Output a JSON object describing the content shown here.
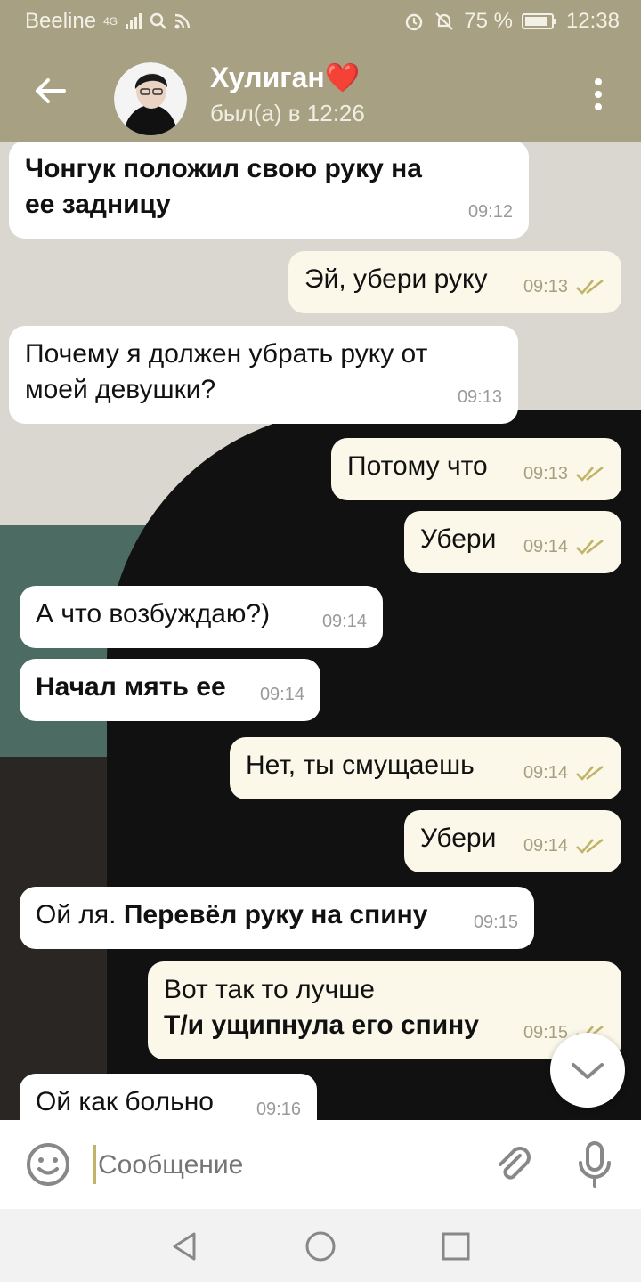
{
  "status_bar": {
    "carrier": "Beeline",
    "network": "4G",
    "battery": "75 %",
    "time": "12:38"
  },
  "header": {
    "title": "Хулиган❤️",
    "subtitle": "был(а) в 12:26"
  },
  "messages": [
    {
      "side": "in",
      "parts": [
        {
          "text": "Чонгук положил свою руку на ее задницу",
          "bold": true
        }
      ],
      "time": "09:12"
    },
    {
      "side": "out",
      "parts": [
        {
          "text": "Эй, убери руку",
          "bold": false
        }
      ],
      "time": "09:13"
    },
    {
      "side": "in",
      "parts": [
        {
          "text": "Почему я должен убрать руку от моей девушки?",
          "bold": false
        }
      ],
      "time": "09:13"
    },
    {
      "side": "out",
      "parts": [
        {
          "text": "Потому что",
          "bold": false
        }
      ],
      "time": "09:13"
    },
    {
      "side": "out",
      "parts": [
        {
          "text": "Убери",
          "bold": false
        }
      ],
      "time": "09:14"
    },
    {
      "side": "in",
      "parts": [
        {
          "text": "А что возбуждаю?)",
          "bold": false
        }
      ],
      "time": "09:14"
    },
    {
      "side": "in",
      "parts": [
        {
          "text": "Начал мять ее",
          "bold": true
        }
      ],
      "time": "09:14"
    },
    {
      "side": "out",
      "parts": [
        {
          "text": "Нет, ты смущаешь",
          "bold": false
        }
      ],
      "time": "09:14"
    },
    {
      "side": "out",
      "parts": [
        {
          "text": "Убери",
          "bold": false
        }
      ],
      "time": "09:14"
    },
    {
      "side": "in",
      "parts": [
        {
          "text": "Ой ля. ",
          "bold": false
        },
        {
          "text": "Перевёл руку на спину",
          "bold": true
        }
      ],
      "time": "09:15"
    },
    {
      "side": "out",
      "parts": [
        {
          "text": "Вот так то лучше",
          "bold": false
        },
        {
          "text": "Т/и ущипнула его спину",
          "bold": true
        }
      ],
      "time": "09:15"
    },
    {
      "side": "in",
      "parts": [
        {
          "text": "Ой как больно",
          "bold": false
        }
      ],
      "time": "09:16"
    }
  ],
  "composer": {
    "placeholder": "Сообщение"
  },
  "colors": {
    "header": "#a7a082",
    "outgoing_bubble": "#fbf8ea",
    "incoming_bubble": "#ffffff",
    "check": "#c0b46a"
  }
}
